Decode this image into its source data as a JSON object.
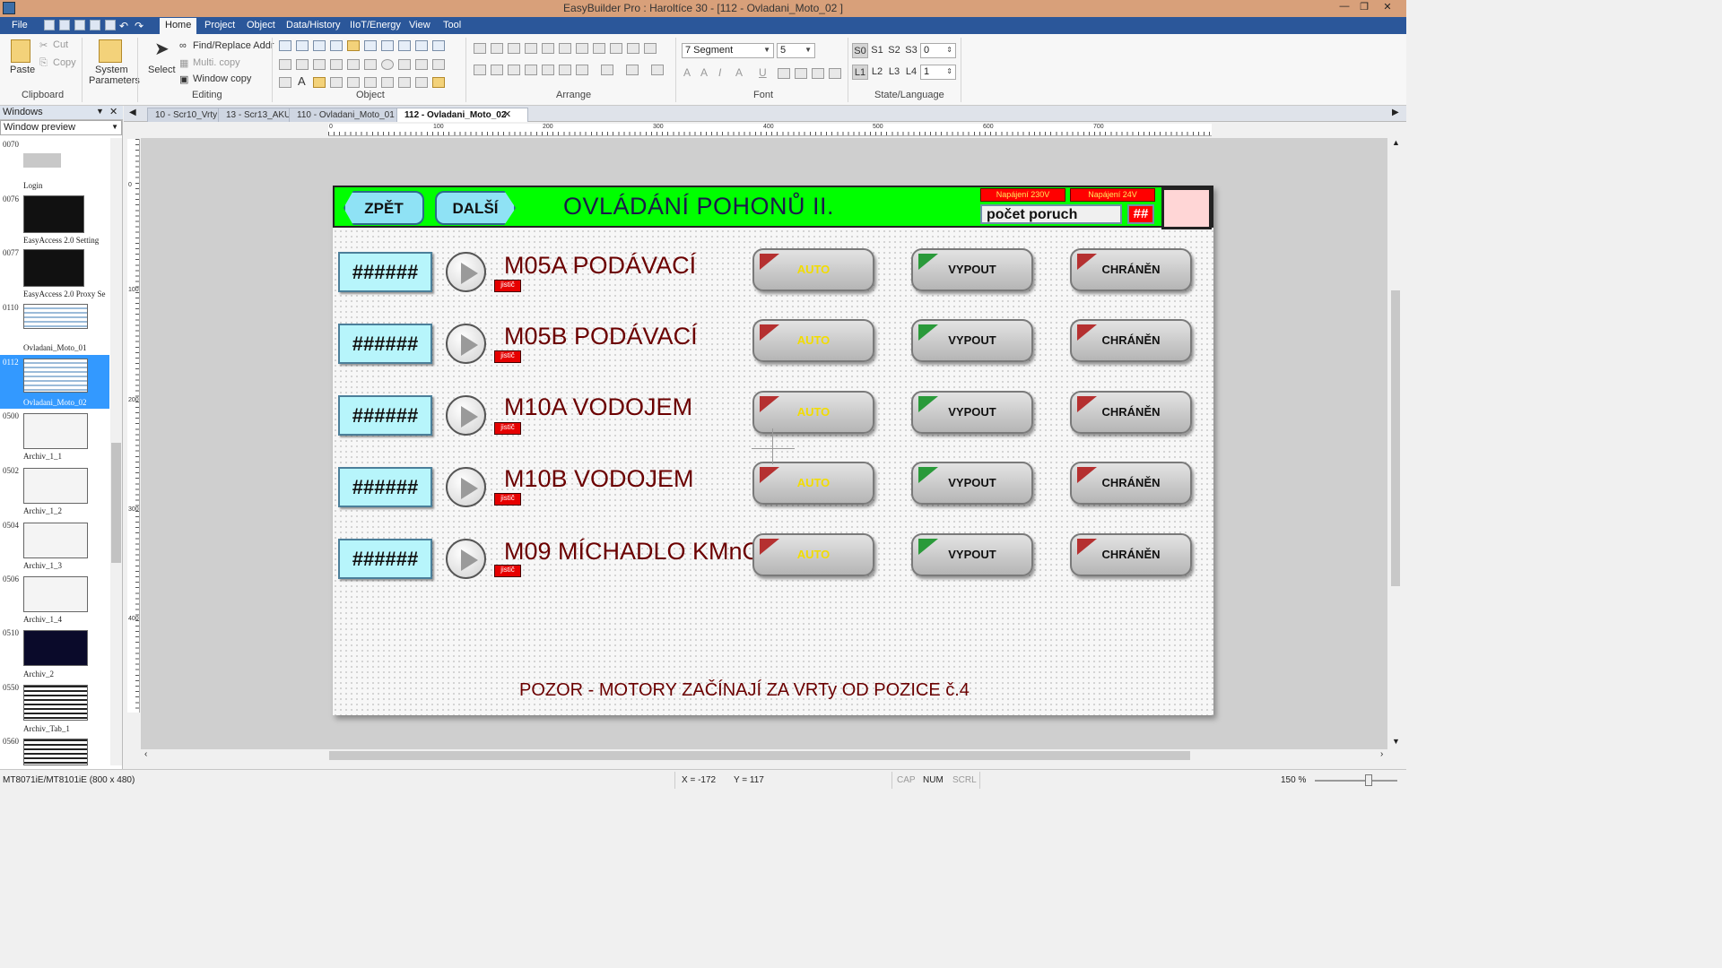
{
  "app": {
    "title": "EasyBuilder Pro : Haroltíce 30 - [112 - Ovladani_Moto_02 ]"
  },
  "menu": {
    "items": [
      "File",
      "Home",
      "Project",
      "Object",
      "Data/History",
      "IIoT/Energy",
      "View",
      "Tool"
    ],
    "active": "Home"
  },
  "ribbon": {
    "clipboard": {
      "label": "Clipboard",
      "paste": "Paste",
      "cut": "Cut",
      "copy": "Copy"
    },
    "params": {
      "label": "System Parameters",
      "line1": "System",
      "line2": "Parameters"
    },
    "editing": {
      "label": "Editing",
      "select": "Select",
      "find_replace": "Find/Replace Addr",
      "multi_copy": "Multi. copy",
      "window_copy": "Window copy"
    },
    "object": {
      "label": "Object"
    },
    "arrange": {
      "label": "Arrange"
    },
    "font": {
      "label": "Font",
      "family": "7 Segment",
      "size": "5"
    },
    "state": {
      "label": "State/Language",
      "states": [
        "S0",
        "S1",
        "S2",
        "S3"
      ],
      "state_value": "0",
      "langs": [
        "L1",
        "L2",
        "L3",
        "L4"
      ],
      "lang_value": "1"
    }
  },
  "windows_panel": {
    "title": "Windows",
    "mode": "Window preview",
    "items": [
      {
        "num": "0070",
        "name": "Login"
      },
      {
        "num": "0076",
        "name": "EasyAccess 2.0 Setting"
      },
      {
        "num": "0077",
        "name": "EasyAccess 2.0 Proxy Se"
      },
      {
        "num": "0110",
        "name": "Ovladani_Moto_01"
      },
      {
        "num": "0112",
        "name": "Ovladani_Moto_02"
      },
      {
        "num": "0500",
        "name": "Archiv_1_1"
      },
      {
        "num": "0502",
        "name": "Archiv_1_2"
      },
      {
        "num": "0504",
        "name": "Archiv_1_3"
      },
      {
        "num": "0506",
        "name": "Archiv_1_4"
      },
      {
        "num": "0510",
        "name": "Archiv_2"
      },
      {
        "num": "0550",
        "name": "Archiv_Tab_1"
      },
      {
        "num": "0560",
        "name": ""
      }
    ],
    "selected": "0112"
  },
  "tabs": [
    {
      "label": "10 - Scr10_Vrty"
    },
    {
      "label": "13 - Scr13_AKU"
    },
    {
      "label": "110 - Ovladani_Moto_01"
    },
    {
      "label": "112 - Ovladani_Moto_02",
      "close": "✕"
    }
  ],
  "ruler": {
    "h": [
      "0",
      "100",
      "200",
      "300",
      "400",
      "500",
      "600",
      "700"
    ],
    "v": [
      "0",
      "100",
      "200",
      "300",
      "400"
    ]
  },
  "hmi": {
    "back": "ZPĚT",
    "next": "DALŠÍ",
    "title": "OVLÁDÁNÍ POHONŮ II.",
    "power230": "Napájení 230V",
    "power24": "Napájení 24V",
    "fault_label": "počet poruch",
    "fault_count": "##",
    "motors": [
      {
        "value": "######",
        "name": "M05A PODÁVACÍ",
        "breaker": "jistič",
        "auto": "AUTO",
        "off": "VYPOUT",
        "protected": "CHRÁNĚN"
      },
      {
        "value": "######",
        "name": "M05B PODÁVACÍ",
        "breaker": "jistič",
        "auto": "AUTO",
        "off": "VYPOUT",
        "protected": "CHRÁNĚN"
      },
      {
        "value": "######",
        "name": "M10A VODOJEM",
        "breaker": "jistič",
        "auto": "AUTO",
        "off": "VYPOUT",
        "protected": "CHRÁNĚN"
      },
      {
        "value": "######",
        "name": "M10B VODOJEM",
        "breaker": "jistič",
        "auto": "AUTO",
        "off": "VYPOUT",
        "protected": "CHRÁNĚN"
      },
      {
        "value": "######",
        "name": "M09 MÍCHADLO KMnO",
        "breaker": "jistič",
        "auto": "AUTO",
        "off": "VYPOUT",
        "protected": "CHRÁNĚN"
      }
    ],
    "warning": "POZOR - MOTORY ZAČÍNAJÍ ZA VRTy OD POZICE č.4"
  },
  "status": {
    "model": "MT8071iE/MT8101iE (800 x 480)",
    "x": "X = -172",
    "y": "Y = 117",
    "cap": "CAP",
    "num": "NUM",
    "scrl": "SCRL",
    "zoom": "150 %"
  },
  "colors": {
    "menu_bg": "#2b579a",
    "title_bg": "#d8a07a",
    "hmi_header": "#00ff00",
    "motor_text": "#6b0000",
    "auto_text": "#f2dc00"
  }
}
